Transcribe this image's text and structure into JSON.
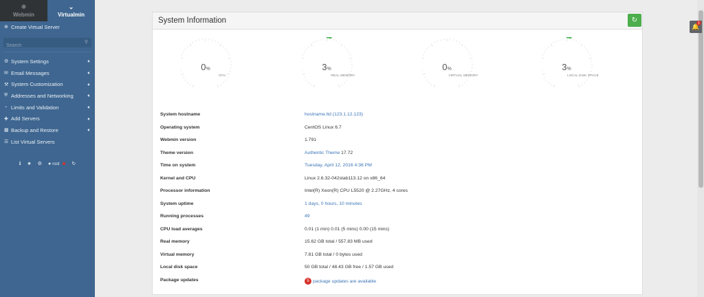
{
  "sidebar": {
    "tabs": [
      {
        "label": "Webmin",
        "icon": "webmin-logo-icon"
      },
      {
        "label": "Virtualmin",
        "icon": "virtualmin-logo-icon"
      }
    ],
    "create_label": "Create Virtual Server",
    "search_placeholder": "Search",
    "menu": [
      {
        "label": "System Settings",
        "icon": "gear-icon"
      },
      {
        "label": "Email Messages",
        "icon": "envelope-icon"
      },
      {
        "label": "System Customization",
        "icon": "wrench-icon"
      },
      {
        "label": "Addresses and Networking",
        "icon": "shield-icon"
      },
      {
        "label": "Limits and Validation",
        "icon": "gauge-icon"
      },
      {
        "label": "Add Servers",
        "icon": "plus-icon"
      },
      {
        "label": "Backup and Restore",
        "icon": "save-icon"
      },
      {
        "label": "List Virtual Servers",
        "icon": "list-icon"
      }
    ],
    "user": "root"
  },
  "panel": {
    "title": "System Information",
    "gauges": [
      {
        "value": "0",
        "unit": "%",
        "label": "CPU",
        "percent": 0
      },
      {
        "value": "3",
        "unit": "%",
        "label": "REAL MEMORY",
        "percent": 3
      },
      {
        "value": "0",
        "unit": "%",
        "label": "VIRTUAL MEMORY",
        "percent": 0
      },
      {
        "value": "3",
        "unit": "%",
        "label": "LOCAL DISK SPACE",
        "percent": 3
      }
    ],
    "info": [
      {
        "label": "System hostname",
        "value": "hostname.ltd (123.1.12.123)",
        "link": true
      },
      {
        "label": "Operating system",
        "value": "CentOS Linux 6.7",
        "link": false
      },
      {
        "label": "Webmin version",
        "value": "1.791",
        "link": false
      },
      {
        "label": "Theme version",
        "value": "Authentic Theme",
        "value2": "17.72",
        "link": true
      },
      {
        "label": "Time on system",
        "value": "Tuesday, April 12, 2016 4:36 PM",
        "link": true
      },
      {
        "label": "Kernel and CPU",
        "value": "Linux 2.6.32-042stab113.12 on x86_64",
        "link": false
      },
      {
        "label": "Processor information",
        "value": "Intel(R) Xeon(R) CPU L5520 @ 2.27GHz, 4 cores",
        "link": false
      },
      {
        "label": "System uptime",
        "value": "1 days, 0 hours, 10 minutes",
        "link": true
      },
      {
        "label": "Running processes",
        "value": "49",
        "link": true
      },
      {
        "label": "CPU load averages",
        "value": "0.01 (1 min) 0.01 (5 mins) 0.00 (15 mins)",
        "link": false
      },
      {
        "label": "Real memory",
        "value": "15.62 GB total / 557.83 MB used",
        "link": false
      },
      {
        "label": "Virtual memory",
        "value": "7.81 GB total / 0 bytes used",
        "link": false
      },
      {
        "label": "Local disk space",
        "value": "50 GB total / 48.43 GB free / 1.57 GB used",
        "link": false
      },
      {
        "label": "Package updates",
        "badge": "5",
        "value": "package updates are available",
        "link": true
      }
    ]
  },
  "notifications": {
    "count": "1"
  },
  "colors": {
    "sidebar": "#3e6690",
    "accent_green": "#4cae4c",
    "gauge_arc": "#3cb44b",
    "link": "#3a74b5"
  }
}
